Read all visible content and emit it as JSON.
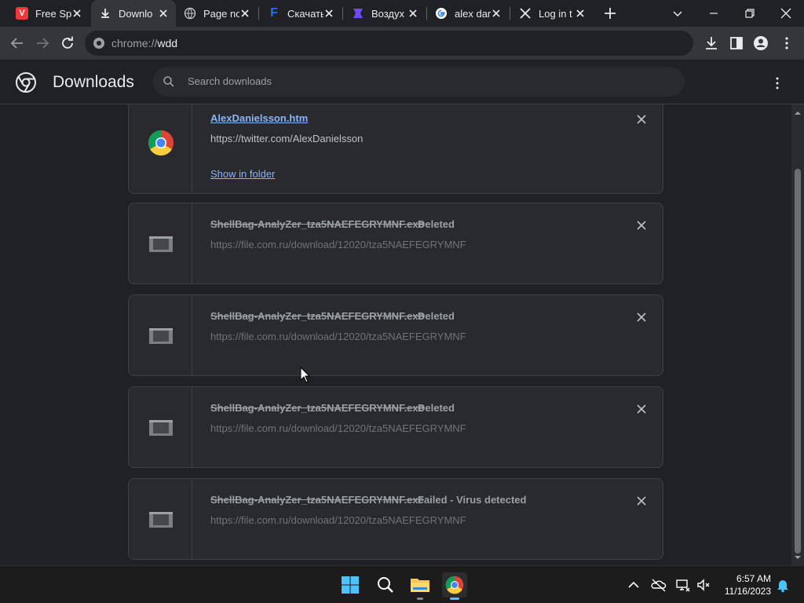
{
  "tabs": [
    {
      "title": "Free Sp",
      "icon": "vivaldi-icon",
      "color": "#ef3939",
      "active": false
    },
    {
      "title": "Downlo",
      "icon": "download-icon",
      "active": true
    },
    {
      "title": "Page no",
      "icon": "globe-icon",
      "active": false
    },
    {
      "title": "Скачать",
      "icon": "f-logo-icon",
      "color": "#1e6fff",
      "active": false
    },
    {
      "title": "Воздух",
      "icon": "proton-icon",
      "color": "#6d4aff",
      "active": false
    },
    {
      "title": "alex dar",
      "icon": "google-icon",
      "active": false
    },
    {
      "title": "Log in t",
      "icon": "x-logo-icon",
      "active": false
    }
  ],
  "omnibox": {
    "url_prefix": "chrome://",
    "url_host": "wdd"
  },
  "downloads": {
    "title": "Downloads",
    "search_placeholder": "Search downloads",
    "items": [
      {
        "filename": "AlexDanielsson.htm",
        "url": "https://twitter.com/AlexDanielsson",
        "status": "",
        "action": "Show in folder"
      },
      {
        "filename": "ShellBag-AnalyZer_tza5NAEFEGRYMNF.exe",
        "url": "https://file.com.ru/download/12020/tza5NAEFEGRYMNF",
        "status": "Deleted"
      },
      {
        "filename": "ShellBag-AnalyZer_tza5NAEFEGRYMNF.exe",
        "url": "https://file.com.ru/download/12020/tza5NAEFEGRYMNF",
        "status": "Deleted"
      },
      {
        "filename": "ShellBag-AnalyZer_tza5NAEFEGRYMNF.exe",
        "url": "https://file.com.ru/download/12020/tza5NAEFEGRYMNF",
        "status": "Deleted"
      },
      {
        "filename": "ShellBag-AnalyZer_tza5NAEFEGRYMNF.exe",
        "url": "https://file.com.ru/download/12020/tza5NAEFEGRYMNF",
        "status": "Failed - Virus detected"
      }
    ]
  },
  "taskbar": {
    "time": "6:57 AM",
    "date": "11/16/2023"
  },
  "colors": {
    "bg": "#202124",
    "card": "#292a2d",
    "link": "#8ab4f8",
    "accent": "#4cc2ff"
  }
}
